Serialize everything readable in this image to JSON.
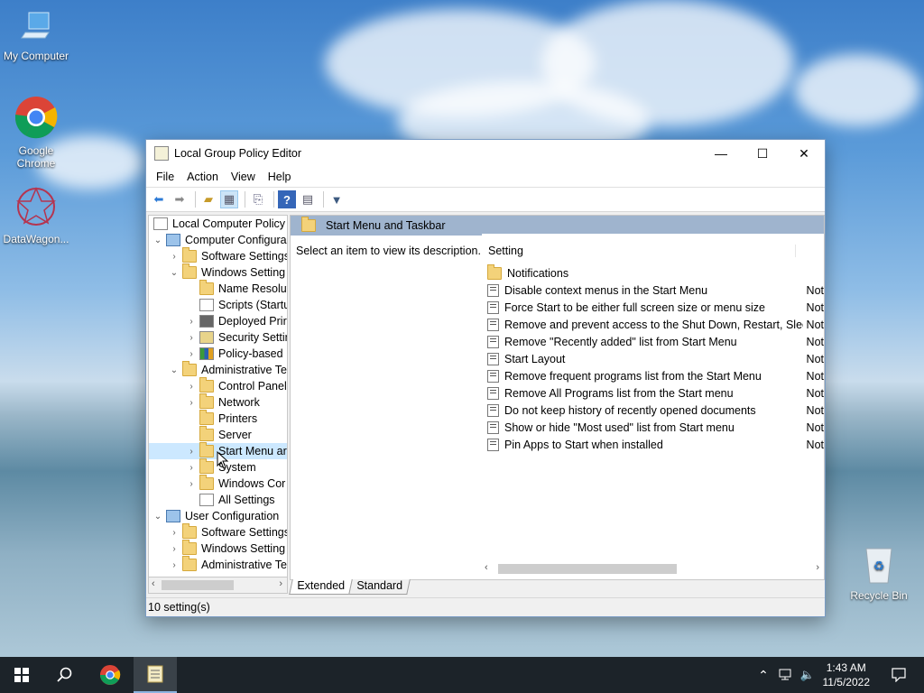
{
  "desktop": {
    "icons": [
      {
        "label": "My Computer",
        "icon": "computer-icon"
      },
      {
        "label": "Google Chrome",
        "icon": "chrome-icon"
      },
      {
        "label": "DataWagon...",
        "icon": "datawagon-icon"
      },
      {
        "label": "Recycle Bin",
        "icon": "recycle-bin-icon"
      }
    ]
  },
  "window": {
    "title": "Local Group Policy Editor",
    "controls": {
      "minimize": "—",
      "maximize": "☐",
      "close": "✕"
    },
    "menu": [
      "File",
      "Action",
      "View",
      "Help"
    ],
    "toolbar": [
      "back-icon",
      "forward-icon",
      "up-folder-icon",
      "show-hide-tree-icon",
      "export-list-icon",
      "help-icon",
      "properties-icon",
      "filter-icon"
    ],
    "tree": [
      {
        "label": "Local Computer Policy",
        "expander": "",
        "icon": "doc"
      },
      {
        "label": "Computer Configura",
        "expander": "⌄",
        "icon": "pc"
      },
      {
        "label": "Software Settings",
        "expander": "›",
        "icon": "folder"
      },
      {
        "label": "Windows Setting",
        "expander": "⌄",
        "icon": "folder"
      },
      {
        "label": "Name Resolut",
        "expander": "",
        "icon": "folder"
      },
      {
        "label": "Scripts (Startu",
        "expander": "",
        "icon": "doc"
      },
      {
        "label": "Deployed Prir",
        "expander": "›",
        "icon": "doc"
      },
      {
        "label": "Security Settin",
        "expander": "›",
        "icon": "doc"
      },
      {
        "label": "Policy-based",
        "expander": "›",
        "icon": "doc"
      },
      {
        "label": "Administrative Te",
        "expander": "⌄",
        "icon": "folder"
      },
      {
        "label": "Control Panel",
        "expander": "›",
        "icon": "folder"
      },
      {
        "label": "Network",
        "expander": "›",
        "icon": "folder"
      },
      {
        "label": "Printers",
        "expander": "",
        "icon": "folder"
      },
      {
        "label": "Server",
        "expander": "",
        "icon": "folder"
      },
      {
        "label": "Start Menu ar",
        "expander": "›",
        "icon": "folder"
      },
      {
        "label": "System",
        "expander": "›",
        "icon": "folder"
      },
      {
        "label": "Windows Cor",
        "expander": "›",
        "icon": "folder"
      },
      {
        "label": "All Settings",
        "expander": "",
        "icon": "doc"
      },
      {
        "label": "User Configuration",
        "expander": "⌄",
        "icon": "pc"
      },
      {
        "label": "Software Settings",
        "expander": "›",
        "icon": "folder"
      },
      {
        "label": "Windows Setting",
        "expander": "›",
        "icon": "folder"
      },
      {
        "label": "Administrative Te",
        "expander": "›",
        "icon": "folder"
      }
    ],
    "right_header": "Start Menu and Taskbar",
    "description": "Select an item to view its description.",
    "column_setting": "Setting",
    "settings": [
      {
        "name": "Notifications",
        "state": "",
        "folder": true
      },
      {
        "name": "Disable context menus in the Start Menu",
        "state": "Not"
      },
      {
        "name": "Force Start to be either full screen size or menu size",
        "state": "Not"
      },
      {
        "name": "Remove and prevent access to the Shut Down, Restart, Sleep...",
        "state": "Not"
      },
      {
        "name": "Remove \"Recently added\" list from Start Menu",
        "state": "Not"
      },
      {
        "name": "Start Layout",
        "state": "Not"
      },
      {
        "name": "Remove frequent programs list from the Start Menu",
        "state": "Not"
      },
      {
        "name": "Remove All Programs list from the Start menu",
        "state": "Not"
      },
      {
        "name": "Do not keep history of recently opened documents",
        "state": "Not"
      },
      {
        "name": "Show or hide \"Most used\" list from Start menu",
        "state": "Not"
      },
      {
        "name": "Pin Apps to Start when installed",
        "state": "Not"
      }
    ],
    "tabs": [
      "Extended",
      "Standard"
    ],
    "status": "10 setting(s)"
  },
  "taskbar": {
    "time": "1:43 AM",
    "date": "11/5/2022",
    "icons": [
      "windows-start-icon",
      "search-icon",
      "chrome-icon",
      "policy-editor-icon",
      "chevron-up-icon",
      "network-icon",
      "volume-icon",
      "notification-icon"
    ]
  }
}
